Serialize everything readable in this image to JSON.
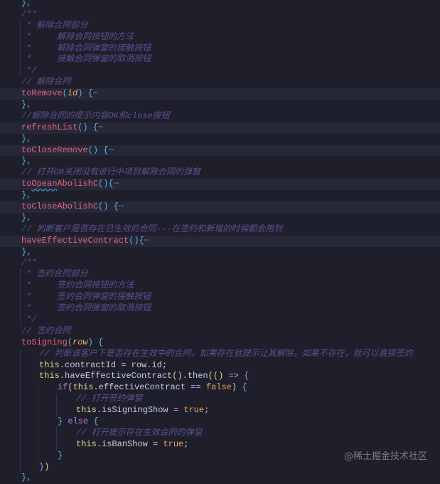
{
  "editor": {
    "lines": [
      {
        "indent": 0,
        "hl": false,
        "tokens": [
          [
            "},",
            "pn"
          ]
        ]
      },
      {
        "indent": 0,
        "hl": false,
        "tokens": [
          [
            "/**",
            "cm"
          ]
        ]
      },
      {
        "indent": 1,
        "hl": false,
        "tokens": [
          [
            "* 解除合同部分",
            "cm"
          ]
        ]
      },
      {
        "indent": 1,
        "hl": false,
        "tokens": [
          [
            "*     解除合同按钮的方法",
            "cm"
          ]
        ]
      },
      {
        "indent": 1,
        "hl": false,
        "tokens": [
          [
            "*     解除合同弹窗的接触按钮",
            "cm"
          ]
        ]
      },
      {
        "indent": 1,
        "hl": false,
        "tokens": [
          [
            "*     接触合同弹窗的取消按钮",
            "cm"
          ]
        ]
      },
      {
        "indent": 1,
        "hl": false,
        "tokens": [
          [
            "*/",
            "cm"
          ]
        ]
      },
      {
        "indent": 0,
        "hl": false,
        "tokens": [
          [
            "// 解除合同",
            "cm"
          ]
        ]
      },
      {
        "indent": 0,
        "hl": true,
        "tokens": [
          [
            "toRemove",
            "fn"
          ],
          [
            "(",
            "pn"
          ],
          [
            "id",
            "pa"
          ],
          [
            ")",
            "pn"
          ],
          [
            " ",
            "tx"
          ],
          [
            "{",
            "pn"
          ],
          [
            "⋯",
            "fo"
          ]
        ]
      },
      {
        "indent": 0,
        "hl": false,
        "tokens": [
          [
            "},",
            "pn"
          ]
        ]
      },
      {
        "indent": 0,
        "hl": false,
        "tokens": [
          [
            "//解除合同的提示内容OK和close按钮",
            "cm"
          ]
        ]
      },
      {
        "indent": 0,
        "hl": true,
        "tokens": [
          [
            "refreshList",
            "fn"
          ],
          [
            "()",
            "pn"
          ],
          [
            " ",
            "tx"
          ],
          [
            "{",
            "pn"
          ],
          [
            "⋯",
            "fo"
          ]
        ]
      },
      {
        "indent": 0,
        "hl": false,
        "tokens": [
          [
            "},",
            "pn"
          ]
        ]
      },
      {
        "indent": 0,
        "hl": true,
        "tokens": [
          [
            "toCloseRemove",
            "fn"
          ],
          [
            "()",
            "pn"
          ],
          [
            " ",
            "tx"
          ],
          [
            "{",
            "pn"
          ],
          [
            "⋯",
            "fo"
          ]
        ]
      },
      {
        "indent": 0,
        "hl": false,
        "tokens": [
          [
            "},",
            "pn"
          ]
        ]
      },
      {
        "indent": 0,
        "hl": false,
        "tokens": [
          [
            "// 打开OR关闭没有进行中项目解除合同的弹窗",
            "cm"
          ]
        ]
      },
      {
        "indent": 0,
        "hl": true,
        "tokens": [
          [
            "to",
            "fn"
          ],
          [
            "Opean",
            "fn sq"
          ],
          [
            "AbolishC",
            "fn"
          ],
          [
            "(){",
            "pn"
          ],
          [
            "⋯",
            "fo"
          ]
        ]
      },
      {
        "indent": 0,
        "hl": false,
        "tokens": [
          [
            "},",
            "pn"
          ]
        ]
      },
      {
        "indent": 0,
        "hl": true,
        "tokens": [
          [
            "toCloseAbolishC",
            "fn"
          ],
          [
            "()",
            "pn"
          ],
          [
            " ",
            "tx"
          ],
          [
            "{",
            "pn"
          ],
          [
            "⋯",
            "fo"
          ]
        ]
      },
      {
        "indent": 0,
        "hl": false,
        "tokens": [
          [
            "},",
            "pn"
          ]
        ]
      },
      {
        "indent": 0,
        "hl": false,
        "tokens": [
          [
            "// 判断客户是否存在已生效的合同---在签约和新增的时候都会用到",
            "cm"
          ]
        ]
      },
      {
        "indent": 0,
        "hl": true,
        "tokens": [
          [
            "haveEffectiveContract",
            "fn"
          ],
          [
            "(){",
            "pn"
          ],
          [
            "⋯",
            "fo"
          ]
        ]
      },
      {
        "indent": 0,
        "hl": false,
        "tokens": [
          [
            "},",
            "pn"
          ]
        ]
      },
      {
        "indent": 0,
        "hl": false,
        "tokens": [
          [
            "/**",
            "cm"
          ]
        ]
      },
      {
        "indent": 1,
        "hl": false,
        "tokens": [
          [
            "* 签约合同部分",
            "cm"
          ]
        ]
      },
      {
        "indent": 1,
        "hl": false,
        "tokens": [
          [
            "*     签约合同按钮的方法",
            "cm"
          ]
        ]
      },
      {
        "indent": 1,
        "hl": false,
        "tokens": [
          [
            "*     签约合同弹窗的接触按钮",
            "cm"
          ]
        ]
      },
      {
        "indent": 1,
        "hl": false,
        "tokens": [
          [
            "*     签约合同弹窗的取消按钮",
            "cm"
          ]
        ]
      },
      {
        "indent": 1,
        "hl": false,
        "tokens": [
          [
            "*/",
            "cm"
          ]
        ]
      },
      {
        "indent": 0,
        "hl": false,
        "tokens": [
          [
            "// 签约合同",
            "cm"
          ]
        ]
      },
      {
        "indent": 0,
        "hl": false,
        "tokens": [
          [
            "toSigning",
            "fn"
          ],
          [
            "(",
            "pn"
          ],
          [
            "row",
            "pa"
          ],
          [
            ")",
            "pn"
          ],
          [
            " ",
            "tx"
          ],
          [
            "{",
            "pn"
          ]
        ]
      },
      {
        "indent": 2,
        "hl": false,
        "tokens": [
          [
            "// 判断该客户下是否存在生效中的合同，如果存在就提示让其解除，如果不存在，就可以直接签约",
            "cm"
          ]
        ]
      },
      {
        "indent": 2,
        "hl": false,
        "tokens": [
          [
            "this",
            "th"
          ],
          [
            ".contractId ",
            "tx"
          ],
          [
            "=",
            "op"
          ],
          [
            " row.id;",
            "tx"
          ]
        ]
      },
      {
        "indent": 2,
        "hl": false,
        "tokens": [
          [
            "this",
            "th"
          ],
          [
            ".haveEffectiveContract",
            "tx"
          ],
          [
            "()",
            "th"
          ],
          [
            ".then",
            "tx"
          ],
          [
            "(() ",
            "th"
          ],
          [
            "=>",
            "op"
          ],
          [
            " {",
            "kw"
          ]
        ]
      },
      {
        "indent": 3,
        "hl": false,
        "tokens": [
          [
            "if",
            "kw"
          ],
          [
            "(",
            "th"
          ],
          [
            "this",
            "th"
          ],
          [
            ".effectiveContract ",
            "tx"
          ],
          [
            "==",
            "op"
          ],
          [
            " ",
            "tx"
          ],
          [
            "false",
            "bo"
          ],
          [
            ")",
            "th"
          ],
          [
            " {",
            "pn"
          ]
        ]
      },
      {
        "indent": 4,
        "hl": false,
        "tokens": [
          [
            "// 打开签约弹窗",
            "cm"
          ]
        ]
      },
      {
        "indent": 4,
        "hl": false,
        "tokens": [
          [
            "this",
            "th"
          ],
          [
            ".isSigningShow ",
            "tx"
          ],
          [
            "=",
            "op"
          ],
          [
            " ",
            "tx"
          ],
          [
            "true",
            "bo"
          ],
          [
            ";",
            "tx"
          ]
        ]
      },
      {
        "indent": 3,
        "hl": false,
        "tokens": [
          [
            "}",
            "pn"
          ],
          [
            " else ",
            "kw"
          ],
          [
            "{",
            "pn"
          ]
        ]
      },
      {
        "indent": 4,
        "hl": false,
        "tokens": [
          [
            "// 打开提示存在生效合同的弹窗",
            "cm"
          ]
        ]
      },
      {
        "indent": 4,
        "hl": false,
        "tokens": [
          [
            "this",
            "th"
          ],
          [
            ".isBanShow ",
            "tx"
          ],
          [
            "=",
            "op"
          ],
          [
            " ",
            "tx"
          ],
          [
            "true",
            "bo"
          ],
          [
            ";",
            "tx"
          ]
        ]
      },
      {
        "indent": 3,
        "hl": false,
        "tokens": [
          [
            "}",
            "pn"
          ]
        ]
      },
      {
        "indent": 2,
        "hl": false,
        "tokens": [
          [
            "}",
            "kw"
          ],
          [
            ")",
            "th"
          ]
        ]
      },
      {
        "indent": 0,
        "hl": false,
        "tokens": [
          [
            "},",
            "pn"
          ]
        ]
      }
    ]
  },
  "watermark": "@稀土掘金技术社区"
}
